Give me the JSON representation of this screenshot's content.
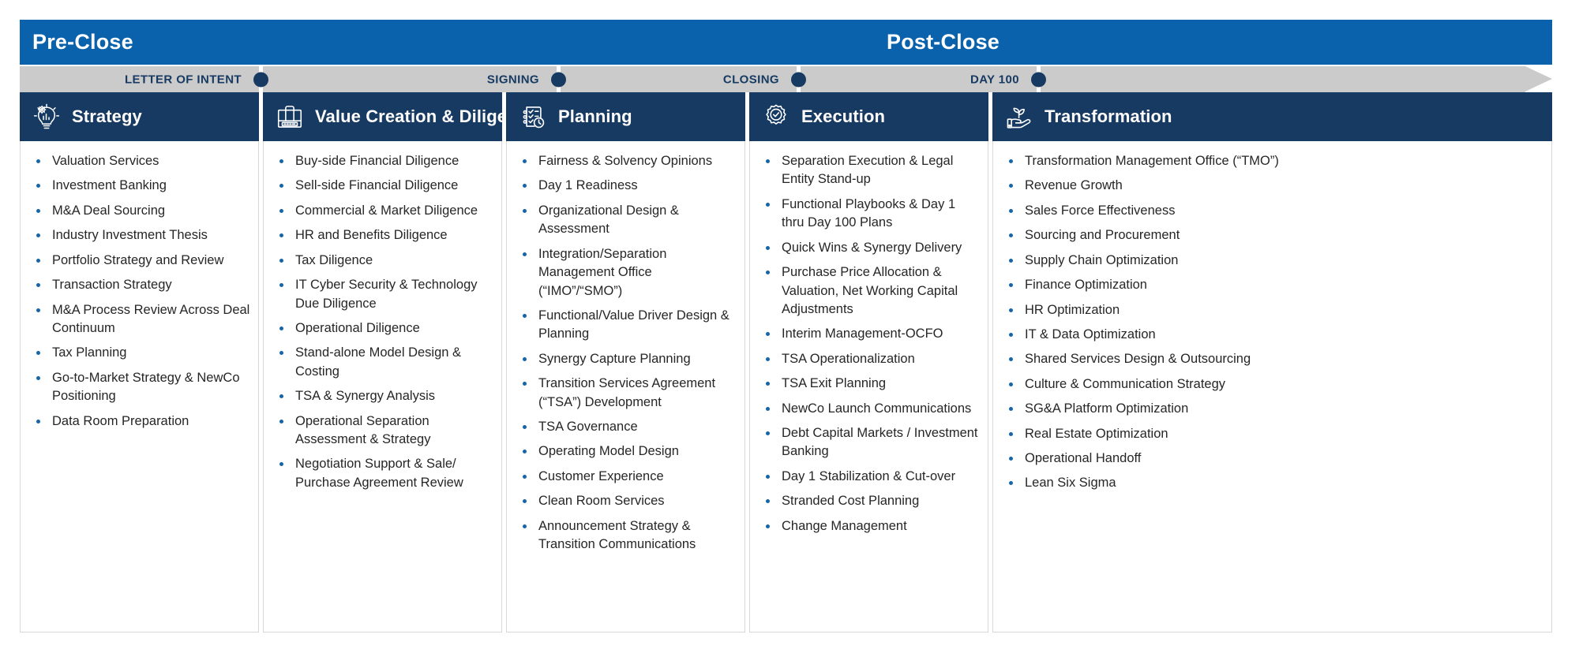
{
  "phases": [
    {
      "label": "Pre-Close"
    },
    {
      "label": "Post-Close"
    }
  ],
  "milestones": [
    {
      "label": "LETTER OF INTENT"
    },
    {
      "label": "SIGNING"
    },
    {
      "label": "CLOSING"
    },
    {
      "label": "DAY 100"
    }
  ],
  "colors": {
    "phase_band_blue": "#0a62ac",
    "header_navy": "#173a63",
    "timeline_gray": "#cbcbcb",
    "bullet_blue": "#1565a8",
    "body_text": "#262626"
  },
  "columns": [
    {
      "title": "Strategy",
      "icon": "lightbulb-gear-chart-icon",
      "items": [
        "Valuation Services",
        "Investment Banking",
        "M&A Deal Sourcing",
        "Industry Investment Thesis",
        "Portfolio Strategy and Review",
        "Transaction Strategy",
        "M&A Process Review Across Deal Continuum",
        "Tax Planning",
        "Go-to-Market Strategy & NewCo Positioning",
        "Data Room Preparation"
      ]
    },
    {
      "title": "Value Creation & Diligence",
      "icon": "briefcase-icon",
      "items": [
        "Buy-side Financial Diligence",
        "Sell-side Financial Diligence",
        "Commercial & Market Diligence",
        "HR and Benefits Diligence",
        "Tax Diligence",
        "IT Cyber Security & Technology Due Diligence",
        "Operational Diligence",
        "Stand-alone Model Design & Costing",
        "TSA & Synergy Analysis",
        "Operational Separation Assessment & Strategy",
        "Negotiation Support & Sale/ Purchase Agreement Review"
      ]
    },
    {
      "title": "Planning",
      "icon": "checklist-clock-icon",
      "items": [
        "Fairness & Solvency Opinions",
        "Day 1 Readiness",
        "Organizational Design & Assessment",
        "Integration/Separation Management Office (“IMO”/“SMO”)",
        "Functional/Value Driver Design & Planning",
        "Synergy Capture Planning",
        "Transition Services Agreement (“TSA”) Development",
        "TSA Governance",
        "Operating Model Design",
        "Customer Experience",
        "Clean Room Services",
        "Announcement Strategy & Transition Communications"
      ]
    },
    {
      "title": "Execution",
      "icon": "gear-check-icon",
      "items": [
        "Separation Execution & Legal Entity Stand-up",
        "Functional Playbooks & Day 1 thru Day 100 Plans",
        "Quick Wins & Synergy Delivery",
        "Purchase Price Allocation & Valuation, Net Working Capital Adjustments",
        "Interim Management-OCFO",
        "TSA Operationalization",
        "TSA Exit Planning",
        "NewCo Launch Communications",
        "Debt Capital Markets / Investment Banking",
        "Day 1 Stabilization & Cut-over",
        "Stranded Cost Planning",
        "Change Management"
      ]
    },
    {
      "title": "Transformation",
      "icon": "hand-sprout-icon",
      "items": [
        "Transformation Management Office (“TMO”)",
        "Revenue Growth",
        "Sales Force Effectiveness",
        "Sourcing and Procurement",
        "Supply Chain Optimization",
        "Finance Optimization",
        "HR Optimization",
        "IT & Data Optimization",
        "Shared Services Design & Outsourcing",
        "Culture & Communication Strategy",
        "SG&A Platform Optimization",
        "Real Estate Optimization",
        "Operational Handoff",
        "Lean Six Sigma"
      ]
    }
  ]
}
